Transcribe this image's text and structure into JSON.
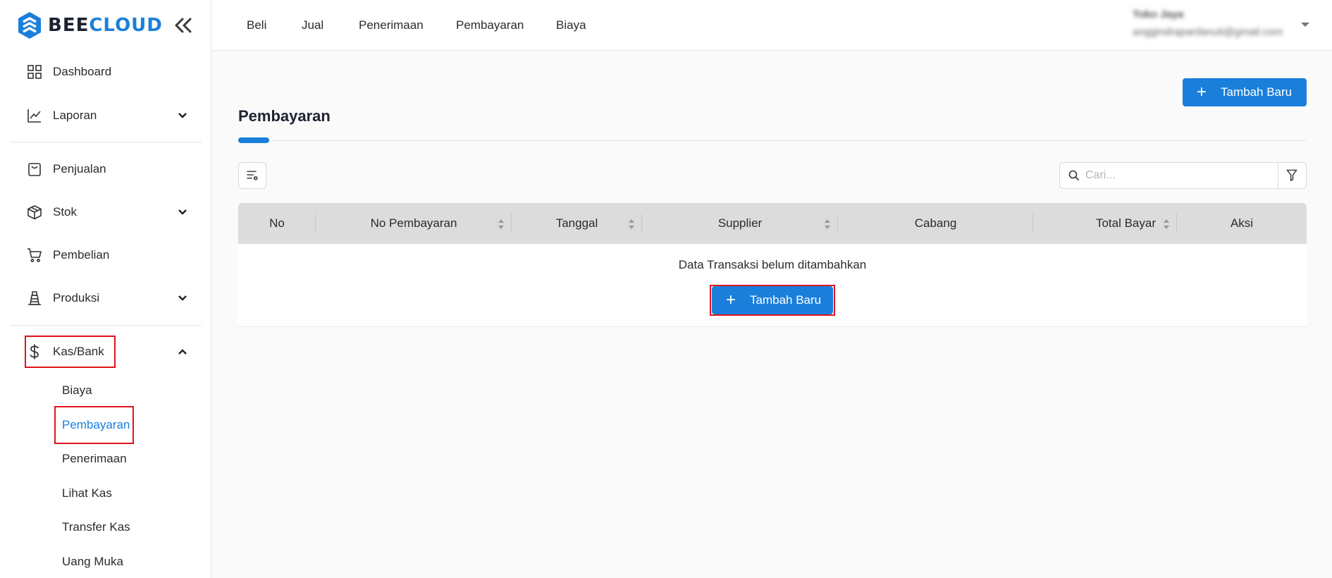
{
  "brand": {
    "part1": "BEE",
    "part2": "CLOUD"
  },
  "sidebar": {
    "items": [
      {
        "label": "Dashboard"
      },
      {
        "label": "Laporan"
      },
      {
        "label": "Penjualan"
      },
      {
        "label": "Stok"
      },
      {
        "label": "Pembelian"
      },
      {
        "label": "Produksi"
      },
      {
        "label": "Kas/Bank"
      }
    ],
    "kas_sub": [
      {
        "label": "Biaya"
      },
      {
        "label": "Pembayaran"
      },
      {
        "label": "Penerimaan"
      },
      {
        "label": "Lihat Kas"
      },
      {
        "label": "Transfer Kas"
      },
      {
        "label": "Uang Muka"
      }
    ]
  },
  "topnav": [
    "Beli",
    "Jual",
    "Penerimaan",
    "Pembayaran",
    "Biaya"
  ],
  "user": {
    "name": "Toko Jaya",
    "email": "anggindrapardanuti@gmail.com"
  },
  "page": {
    "title": "Pembayaran",
    "add_label": "Tambah Baru",
    "search_placeholder": "Cari..."
  },
  "table": {
    "columns": [
      "No",
      "No Pembayaran",
      "Tanggal",
      "Supplier",
      "Cabang",
      "Total Bayar",
      "Aksi"
    ],
    "empty_message": "Data Transaksi belum ditambahkan",
    "empty_add_label": "Tambah Baru"
  },
  "colors": {
    "accent": "#1a7fdb",
    "highlight": "#e0141b"
  }
}
